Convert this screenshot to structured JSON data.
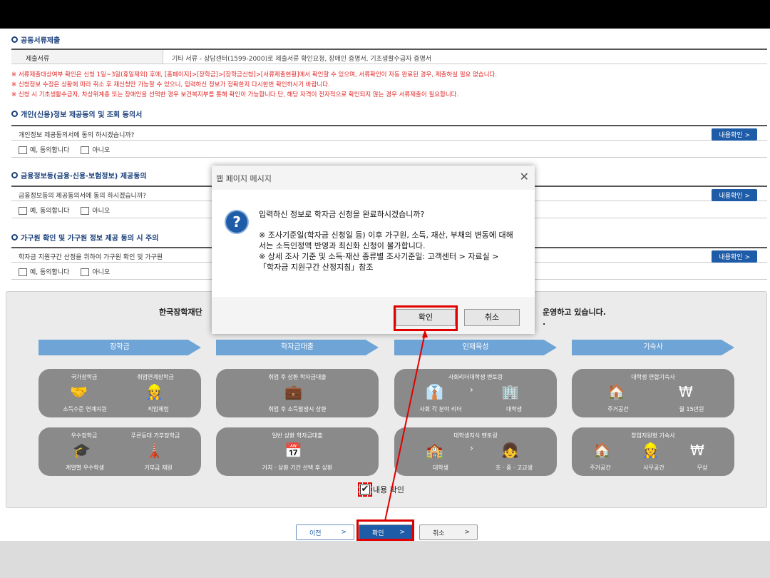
{
  "sections": {
    "docs_title": "공동서류제출",
    "docs_label": "제출서류",
    "docs_value": "기타 서류 - 상담센터(1599-2000)로 제출서류 확인요청, 장애인 증명서, 기초생활수급자 증명서",
    "notices": [
      "※ 서류제출대상여부 확인은 신청 1일~3일(휴일제외) 후에, [홈페이지]>[장학금]>[장학금신청]>[서류제출현황]에서 확인할 수 있으며, 서류확인이 자동 완료된 경우, 제출하실 필요 없습니다.",
      "※ 신청정보 수정은 상황에 따라 취소 후 재신청만 가능할 수 있으니, 입력하신 정보가 정확한지 다시한번 확인하시기 바랍니다.",
      "※ 신청 시 기초생활수급자, 차상위계층 또는 장애인을 선택한 경우 보건복지부를 통해 확인이 가능합니다.단, 해당 자격이 전자적으로 확인되지 않는 경우 서류제출이 필요합니다."
    ],
    "personal_title": "개인(신용)정보 제공동의 및 조회 동의서",
    "personal_question": "개인정보 제공동의서에 동의 하시겠습니까?",
    "finance_title": "금융정보등(금융·신용·보험정보) 제공동의",
    "finance_question": "금융정보등의 제공동의서에 동의 하시겠습니까?",
    "household_title": "가구원 확인 및 가구원 정보 제공 동의 시 주의",
    "household_question": "학자금 지원구간 산정을 위하여 가구원 확인 및 가구원",
    "agree": "예, 동의합니다",
    "disagree": "아니오",
    "detail_btn": "내용확인 >"
  },
  "panel": {
    "head_left": "한국장학재단",
    "head_right": "운영하고 있습니다.",
    "head_right2": ".",
    "arrows": [
      "장학금",
      "학자금대출",
      "인재육성",
      "기숙사"
    ],
    "cards": [
      {
        "title": "국가장학금",
        "title2": "취업연계장학금",
        "sub1": "소득수준 연계지원",
        "sub2": "직업체험"
      },
      {
        "title": "취업 후 상환 학자금대출",
        "title2": "",
        "sub1": "취업 후 소득발생시 상환",
        "sub2": ""
      },
      {
        "title": "사회리더대학생 멘토링",
        "title2": "",
        "sub1": "사회 각 분야 리더",
        "sub2": "대학생"
      },
      {
        "title": "대학생 연합기숙사",
        "title2": "",
        "sub1": "주거공간",
        "sub2": "월 15만원"
      },
      {
        "title": "우수장학금",
        "title2": "푸른등대 기부장학금",
        "sub1": "계열별 우수학생",
        "sub2": "기부금 재원"
      },
      {
        "title": "일반 상환 학자금대출",
        "title2": "",
        "sub1": "거치 · 상환 기간 선택 후 상환",
        "sub2": ""
      },
      {
        "title": "대학생지식 멘토링",
        "title2": "",
        "sub1": "대학생",
        "sub2": "초 · 중 · 고교생"
      },
      {
        "title": "창업지원형 기숙사",
        "title2": "",
        "sub1": "주거공간",
        "sub2": "사무공간",
        "sub3": "무상"
      }
    ],
    "content_check": "내용 확인"
  },
  "nav": {
    "prev": "이전",
    "ok": "확인",
    "cancel": "취소",
    "chevron": ">"
  },
  "dialog": {
    "title": "웹 페이지 메시지",
    "close": "✕",
    "question": "입력하신 정보로 학자금 신청을 완료하시겠습니까?",
    "note": "※ 조사기준일(학자금 신청일 등) 이후 가구원, 소득, 재산, 부채의 변동에 대해서는 소득인정액 반영과 최신화 신청이 불가합니다.",
    "note2": "※ 상세 조사 기준 및 소득·재산 종류별 조사기준일: 고객센터 > 자료실 > 「학자금 지원구간 산정지침」참조",
    "ok": "확인",
    "cancel": "취소"
  },
  "colors": {
    "accent": "#1f5ca8",
    "highlight": "#e00000",
    "notice": "#e02020"
  }
}
